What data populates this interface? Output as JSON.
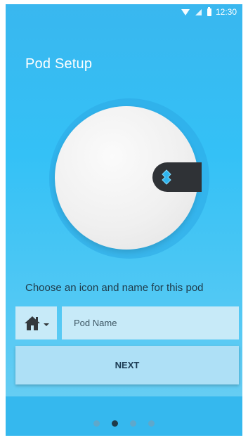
{
  "status_bar": {
    "time": "12:30",
    "icons": [
      "wifi-icon",
      "signal-icon",
      "battery-icon"
    ]
  },
  "header": {
    "title": "Pod Setup"
  },
  "illustration": {
    "name": "pod-device",
    "colors": {
      "disc": "#f0f0f0",
      "button": "#2f3236",
      "light": "#2fb4ee"
    }
  },
  "form": {
    "instruction": "Choose an icon and name for this pod",
    "icon_picker": {
      "selected_icon": "home-icon"
    },
    "name_input": {
      "value": "",
      "placeholder": "Pod Name"
    },
    "next_label": "NEXT"
  },
  "pager": {
    "pages": 4,
    "active_index": 1
  },
  "colors": {
    "background": "#34c1f6",
    "field": "#c7eaf8",
    "button": "#aee0f6",
    "text_dark": "#1f3b4a"
  }
}
